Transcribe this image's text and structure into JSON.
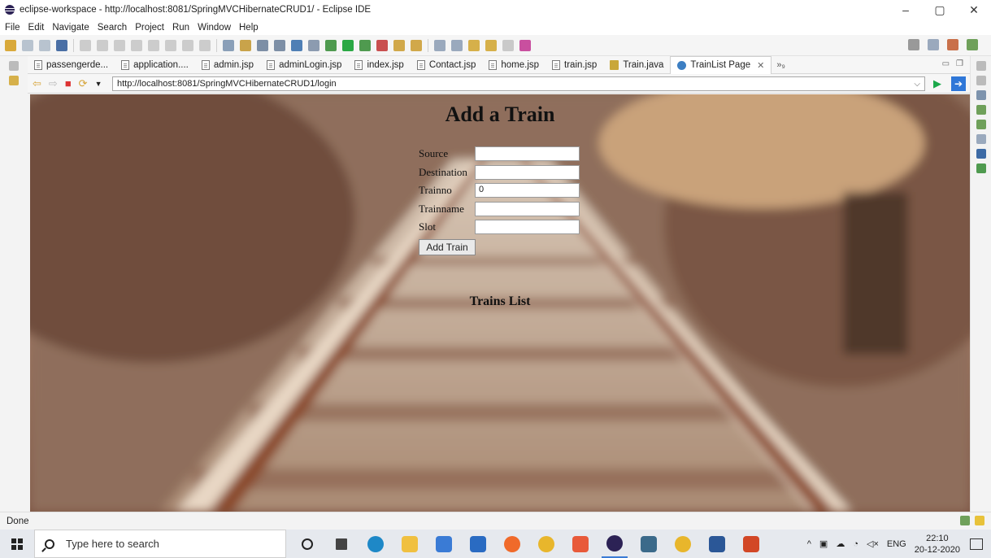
{
  "window": {
    "title": "eclipse-workspace - http://localhost:8081/SpringMVCHibernateCRUD1/ - Eclipse IDE",
    "minimize": "–",
    "restore": "▢",
    "close": "✕"
  },
  "menu": [
    "File",
    "Edit",
    "Navigate",
    "Search",
    "Project",
    "Run",
    "Window",
    "Help"
  ],
  "tabs": [
    {
      "label": "passengerde...",
      "kind": "file"
    },
    {
      "label": "application....",
      "kind": "file"
    },
    {
      "label": "admin.jsp",
      "kind": "file"
    },
    {
      "label": "adminLogin.jsp",
      "kind": "file"
    },
    {
      "label": "index.jsp",
      "kind": "file"
    },
    {
      "label": "Contact.jsp",
      "kind": "file"
    },
    {
      "label": "home.jsp",
      "kind": "file"
    },
    {
      "label": "train.jsp",
      "kind": "file"
    },
    {
      "label": "Train.java",
      "kind": "java"
    },
    {
      "label": "TrainList Page",
      "kind": "browser",
      "active": true
    }
  ],
  "tab_overflow": "»₉",
  "browser": {
    "url": "http://localhost:8081/SpringMVCHibernateCRUD1/login"
  },
  "page": {
    "title": "Add a Train",
    "form": {
      "source_label": "Source",
      "source_value": "",
      "destination_label": "Destination",
      "destination_value": "",
      "trainno_label": "Trainno",
      "trainno_value": "0",
      "trainname_label": "Trainname",
      "trainname_value": "",
      "slot_label": "Slot",
      "slot_value": "",
      "submit_label": "Add Train"
    },
    "list_title": "Trains List"
  },
  "status": {
    "text": "Done"
  },
  "taskbar": {
    "search_placeholder": "Type here to search",
    "language": "ENG",
    "time": "22:10",
    "date": "20-12-2020"
  }
}
